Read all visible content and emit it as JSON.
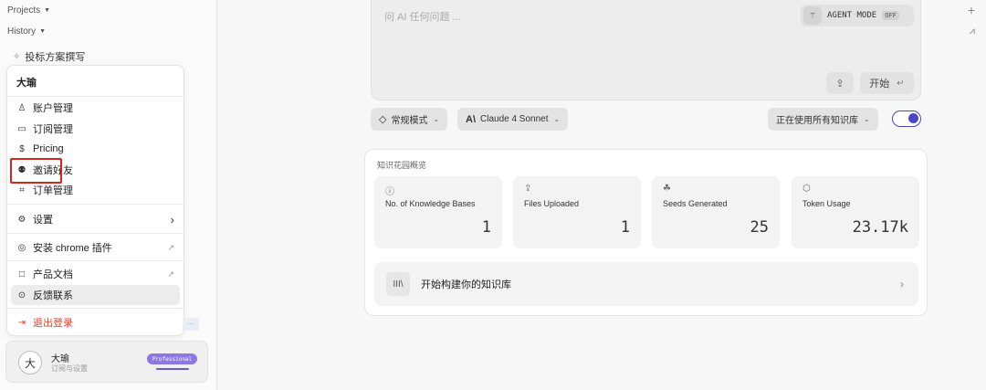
{
  "sidebar": {
    "projects_label": "Projects",
    "projects_add": "+",
    "history_label": "History",
    "history_toggle": "⩘",
    "history_items": [
      {
        "label": "投标方案撰写"
      }
    ]
  },
  "menu": {
    "title": "大瑜",
    "items": [
      {
        "label": "账户管理",
        "icon": "♙"
      },
      {
        "label": "订阅管理",
        "icon": "▭"
      },
      {
        "label": "Pricing",
        "icon": "$"
      },
      {
        "label": "邀请好友",
        "icon": "⚉"
      },
      {
        "label": "订单管理",
        "icon": "⌗"
      },
      {
        "label": "设置",
        "icon": "⚙",
        "tail": "›"
      },
      {
        "label": "安装 chrome 插件",
        "icon": "◎",
        "tail": "↗"
      },
      {
        "label": "产品文档",
        "icon": "□",
        "tail": "↗"
      },
      {
        "label": "反馈联系",
        "icon": "⊙"
      },
      {
        "label": "退出登录",
        "icon": "⇥"
      }
    ]
  },
  "scroll_tag": "...",
  "user": {
    "avatar_char": "大",
    "name": "大瑜",
    "subtitle": "订阅与设置",
    "plan": "Professional"
  },
  "prompt": {
    "placeholder": "问 AI 任何问题 ...",
    "agent_mode_label": "AGENT MODE",
    "agent_mode_state": "OFF",
    "upload_icon": "⇪",
    "start_label": "开始",
    "start_icon": "↵"
  },
  "controls": {
    "mode_label": "常规模式",
    "model_label": "Claude 4 Sonnet",
    "model_icon": "A\\",
    "kb_label": "正在使用所有知识库",
    "kb_toggle_on": true
  },
  "knowledge": {
    "title": "知识花园概览",
    "stats": [
      {
        "label": "No. of Knowledge Bases",
        "value": "1",
        "icon": "ⓘ"
      },
      {
        "label": "Files Uploaded",
        "value": "1",
        "icon": "⇪"
      },
      {
        "label": "Seeds Generated",
        "value": "25",
        "icon": "☘"
      },
      {
        "label": "Token Usage",
        "value": "23.17k",
        "icon": "⬡"
      }
    ],
    "build_label": "开始构建你的知识库",
    "build_icon": "III\\",
    "build_chevron": "›"
  },
  "colors": {
    "accent": "#4b46c9",
    "badge": "#8b78e6",
    "danger": "#e0442e",
    "highlight_box": "#d2271c"
  }
}
